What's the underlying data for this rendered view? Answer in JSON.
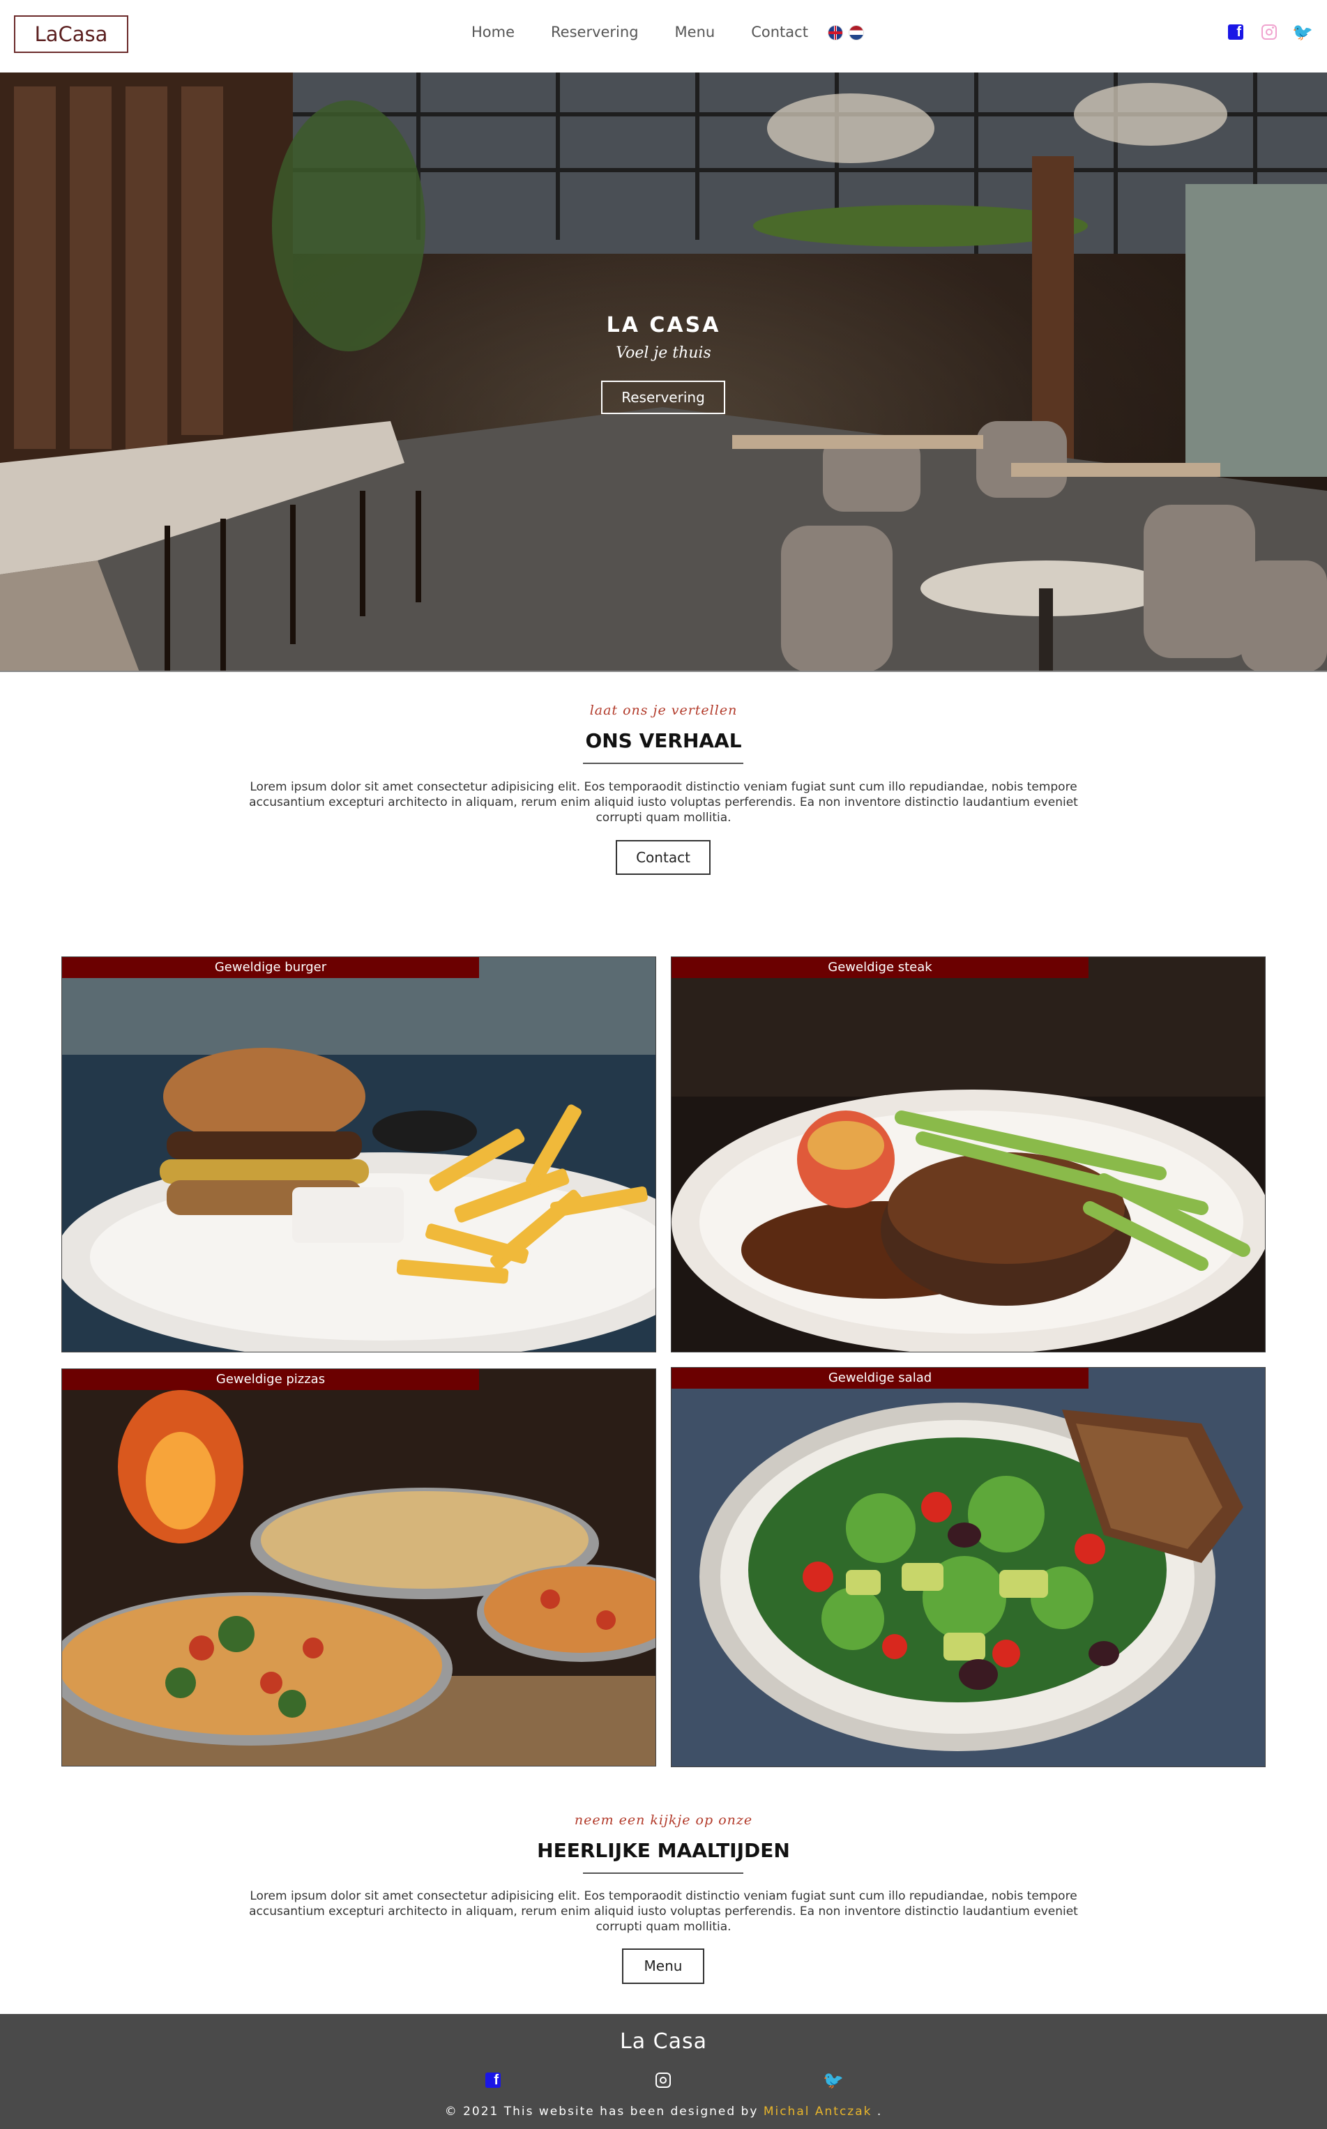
{
  "brand": {
    "logo": "LaCasa"
  },
  "nav": {
    "links": [
      "Home",
      "Reservering",
      "Menu",
      "Contact"
    ],
    "languages": [
      "English",
      "Nederlands"
    ]
  },
  "social": [
    "facebook-icon",
    "instagram-icon",
    "twitter-icon"
  ],
  "colors": {
    "accent": "#6b0000",
    "kicker": "#b23a2a",
    "facebook": "#1a16e6",
    "instagram": "#f0a3cf",
    "twitter": "#55b8e8",
    "footer_bg": "#4a4a4a",
    "author": "#e8b52b"
  },
  "hero": {
    "title": "LA CASA",
    "subtitle": "Voel je thuis",
    "button": "Reservering"
  },
  "story": {
    "kicker": "laat ons je vertellen",
    "title": "ONS VERHAAL",
    "text": "Lorem ipsum dolor sit amet consectetur adipisicing elit. Eos temporaodit distinctio veniam fugiat sunt cum illo repudiandae, nobis tempore accusantium excepturi architecto in aliquam, rerum enim aliquid iusto voluptas perferendis. Ea non inventore distinctio laudantium eveniet corrupti quam mollitia.",
    "button": "Contact"
  },
  "gallery": [
    {
      "label": "Geweldige burger"
    },
    {
      "label": "Geweldige steak"
    },
    {
      "label": "Geweldige pizzas"
    },
    {
      "label": "Geweldige salad"
    }
  ],
  "meals": {
    "kicker": "neem een kijkje op onze",
    "title": "HEERLIJKE MAALTIJDEN",
    "text": "Lorem ipsum dolor sit amet consectetur adipisicing elit. Eos temporaodit distinctio veniam fugiat sunt cum illo repudiandae, nobis tempore accusantium excepturi architecto in aliquam, rerum enim aliquid iusto voluptas perferendis. Ea non inventore distinctio laudantium eveniet corrupti quam mollitia.",
    "button": "Menu"
  },
  "footer": {
    "title": "La Casa",
    "copyright": "© 2021 This website has been designed by",
    "author": "Michal Antczak",
    "suffix": "."
  }
}
